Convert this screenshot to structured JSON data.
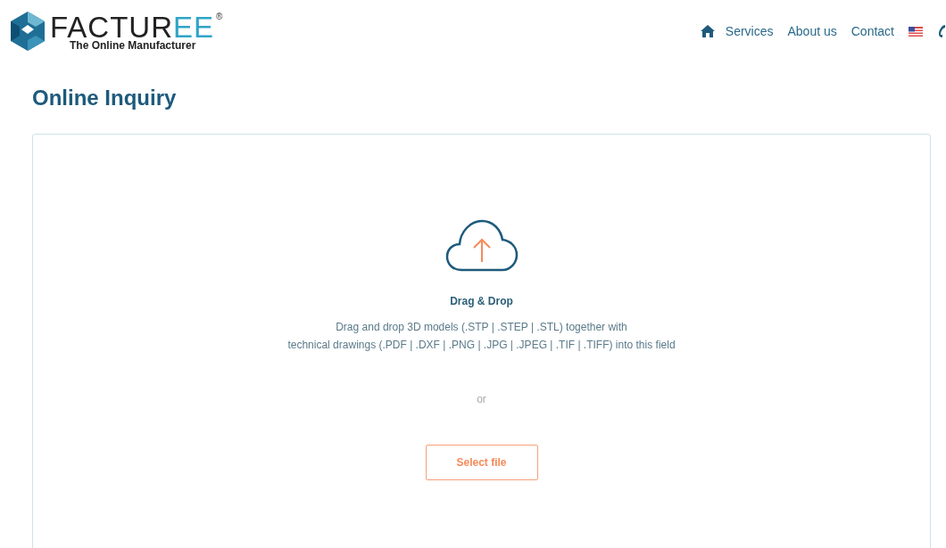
{
  "header": {
    "logo": {
      "wordmark": [
        "FACTUR",
        "EE"
      ],
      "registered": "®",
      "tagline": "The Online Manufacturer"
    },
    "nav": [
      {
        "label": "Services"
      },
      {
        "label": "About us"
      },
      {
        "label": "Contact"
      }
    ]
  },
  "page_title": "Online Inquiry",
  "upload": {
    "heading": "Drag & Drop",
    "lines": [
      "Drag and drop 3D models (.STP | .STEP | .STL) together with",
      "technical drawings (.PDF | .DXF | .PNG | .JPG | .JPEG | .TIF | .TIFF) into this field"
    ],
    "separator": "or",
    "button": "Select file"
  }
}
